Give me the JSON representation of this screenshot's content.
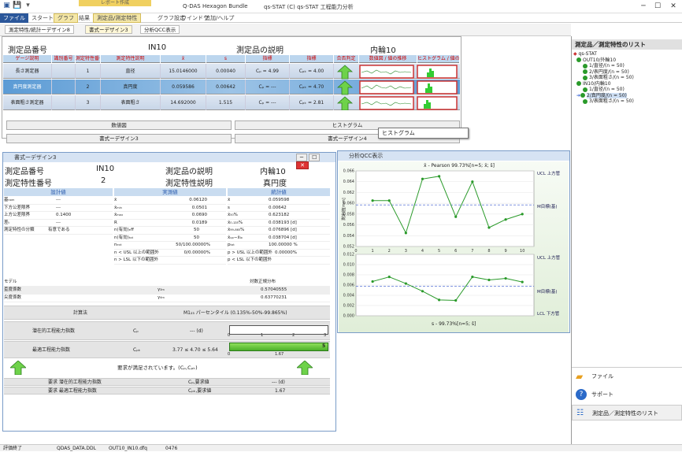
{
  "app": {
    "context_tab": "レポート作成",
    "title_left": "Q-DAS Hexagon Bundle",
    "title_right": "qs-STAT (C) qs-STAT 工程能力分析"
  },
  "menu": [
    "ファイル",
    "スタート",
    "グラフ",
    "結果",
    "測定品/測定特性",
    "グラフ設定",
    "ウインドウ",
    "追加/ヘルプ"
  ],
  "toolbar": {
    "btn1": "測定特性/統計ーデザイン8",
    "btn2": "書式ーデザイン3",
    "btn3": "分析QCC表示"
  },
  "top_report": {
    "part_number_label": "測定品番号",
    "part_number": "IN10",
    "part_desc_label": "測定品の説明",
    "part_desc": "内輪10",
    "columns": [
      "ゲージ説明",
      "識別番号",
      "測定特性番号",
      "測定特性説明",
      "x̄",
      "s",
      "指標",
      "指標",
      "合否判定",
      "数値図 / 値の推移",
      "ヒストグラム / 値の推移"
    ],
    "rows": [
      {
        "name": "長さ測定器",
        "num": "1",
        "desc": "直径",
        "mean": "15.0146000",
        "s": "0.00040",
        "cp": "Cₚ = 4.99",
        "cpk": "Cₚₖ = 4.00"
      },
      {
        "name": "真円度測定器",
        "num": "2",
        "desc": "真円度",
        "mean": "0.059586",
        "s": "0.00642",
        "cp": "Cₚ = ---",
        "cpk": "Cₚₖ = 4.70"
      },
      {
        "name": "表面粗さ測定器",
        "num": "3",
        "desc": "表面粗さ",
        "mean": "14.692000",
        "s": "1.515",
        "cp": "Cₚ = ---",
        "cpk": "Cₚₖ = 2.81"
      }
    ],
    "btn_value_chart": "数値図",
    "btn_histogram": "ヒストグラム",
    "btn_form3": "書式ーデザイン3",
    "btn_form4": "書式ーデザイン4",
    "tooltip": "ヒストグラム"
  },
  "form_window": {
    "title": "書式ーデザイン3",
    "part_no_label": "測定品番号",
    "part_no": "IN10",
    "part_desc_label": "測定品の説明",
    "part_desc": "内輪10",
    "char_no_label": "測定特性番号",
    "char_no": "2",
    "char_desc_label": "測定特性説明",
    "char_desc": "真円度",
    "head1": "設計値",
    "head2": "実測値",
    "head3": "統計値",
    "left_rows": [
      [
        "基ₙₒₘ",
        "---"
      ],
      [
        "下方公差限界",
        "---"
      ],
      [
        "上方公差限界",
        "0.1400"
      ],
      [
        "差ₜ",
        "---"
      ],
      [
        "測定特性の分類",
        "有意である"
      ]
    ],
    "mid_rows": [
      [
        "x̄",
        "0.06120"
      ],
      [
        "x̄ₘᵢₙ",
        "0.0501"
      ],
      [
        "x̄ₘₐₓ",
        "0.0690"
      ],
      [
        "R",
        "0.0189"
      ],
      [
        "n(有効)ₑff",
        "50"
      ],
      [
        "n(有効)ₜₒₜ",
        "50"
      ],
      [
        "nₑₓₜ",
        "50/100.00000%"
      ],
      [
        "n < USL 以上の範囲外",
        "0/0.00000%"
      ],
      [
        "n > LSL 以下の範囲外",
        ""
      ]
    ],
    "right_rows": [
      [
        "x̄",
        "0.059598"
      ],
      [
        "s",
        "0.00642"
      ],
      [
        "x̄₅₀%",
        "0.623182"
      ],
      [
        "x̄₀.₁₃₅%",
        "0.038193 [d]"
      ],
      [
        "x̄₉₉.₈₆₅%",
        "0.076896 [d]"
      ],
      [
        "x̄ᵤₚ−x̄ₗₒ",
        "0.038704 [d]"
      ],
      [
        "pₜₒₜ",
        "100.00000 %"
      ],
      [
        "p > USL 以上の範囲外",
        "0.00000%"
      ],
      [
        "p < LSL 以下の範囲外",
        ""
      ]
    ],
    "model_label": "モデル",
    "model_value": "対数正規分布",
    "skew_label": "歪度係数",
    "skew_sym": "γ₃ₘ",
    "skew_value": "0.57040555",
    "kurt_label": "尖度係数",
    "kurt_sym": "γ₄ₘ",
    "kurt_value": "0.63770231",
    "calc_label": "計算法",
    "calc_value": "M1₂₃ パーセンタイル (0.135%-50%-99.865%)",
    "cp_label": "潜在的工程能力指数",
    "cp_sym": "Cₚ",
    "cp_value": "--- (d)",
    "cpk_label": "最適工程能力指数",
    "cpk_sym": "Cₚₖ",
    "cpk_range": "3.77 ≤ 4.70 ≤ 5.64",
    "scale_ticks": [
      "0",
      "1",
      "2",
      "3"
    ],
    "cpk_bar_end": "5",
    "cpk_tick": "1.67",
    "result_text": "要求が満足されています。(Cₚ,Cₚₖ)",
    "req1_label": "要求 潜在的工程能力指数",
    "req1_sym": "Cₚ,要求値",
    "req1_value": "--- (d)",
    "req2_label": "要求 最適工程能力指数",
    "req2_sym": "Cₚₖ,要求値",
    "req2_value": "1.67"
  },
  "chart_window": {
    "title": "分析QCC表示",
    "upper_title": "x̄ - Pearson 99.73%[n=5; x̄; ŝ]",
    "lower_title": "s - 99.73%[n=5; ŝ]",
    "ucl_label": "UCL 上方管",
    "mid_label": "M目標(基)",
    "lcl_label": "LCL 下方管",
    "ylabel": "測定値[mm]"
  },
  "chart_data": [
    {
      "type": "line",
      "title": "x̄ - Pearson 99.73%[n=5; x̄; ŝ]",
      "x": [
        1,
        2,
        3,
        4,
        5,
        6,
        7,
        8,
        9,
        10
      ],
      "values": [
        0.0605,
        0.0605,
        0.0545,
        0.0645,
        0.065,
        0.0575,
        0.064,
        0.0555,
        0.057,
        0.058
      ],
      "xlim": [
        0,
        10.7
      ],
      "ylim": [
        0.052,
        0.066
      ],
      "y_ticks": [
        "0.052",
        "0.054",
        "0.056",
        "0.058",
        "0.060",
        "0.062",
        "0.064",
        "0.066"
      ],
      "x_ticks": [
        "0",
        "1",
        "2",
        "3",
        "4",
        "5",
        "6",
        "7",
        "8",
        "9",
        "10"
      ],
      "center": 0.0597
    },
    {
      "type": "line",
      "title": "s - 99.73%[n=5; ŝ]",
      "x": [
        1,
        2,
        3,
        4,
        5,
        6,
        7,
        8,
        9,
        10
      ],
      "values": [
        0.0067,
        0.0076,
        0.0063,
        0.0048,
        0.0031,
        0.003,
        0.0076,
        0.007,
        0.0073,
        0.0066
      ],
      "xlim": [
        0,
        10.7
      ],
      "ylim": [
        0,
        0.012
      ],
      "y_ticks": [
        "0.000",
        "0.002",
        "0.004",
        "0.006",
        "0.008",
        "0.010",
        "0.012"
      ],
      "center": 0.0058
    }
  ],
  "right_panel": {
    "title": "測定品／測定特性のリスト",
    "root": "qs-STAT",
    "tree": [
      {
        "label": "OUT10/外輪10",
        "level": 1
      },
      {
        "label": "1/直径/(n = 50)",
        "level": 2
      },
      {
        "label": "2/表円度/(n = 50)",
        "level": 2
      },
      {
        "label": "3/表面粗さ/(n = 50)",
        "level": 2
      },
      {
        "label": "IN10/内輪10",
        "level": 1
      },
      {
        "label": "1/直径/(n = 50)",
        "level": 2
      },
      {
        "label": "2/真円度/(n = 50)",
        "level": 2
      },
      {
        "label": "3/表面粗さ/(n = 50)",
        "level": 2
      }
    ],
    "nav_file": "ファイル",
    "nav_support": "サポート",
    "nav_list": "測定品／測定特性のリスト"
  },
  "status": {
    "left": "評価終了",
    "file": "QDAS_DATA.DDL",
    "doc": "OUT10_IN10.dfq",
    "num": "0476"
  }
}
